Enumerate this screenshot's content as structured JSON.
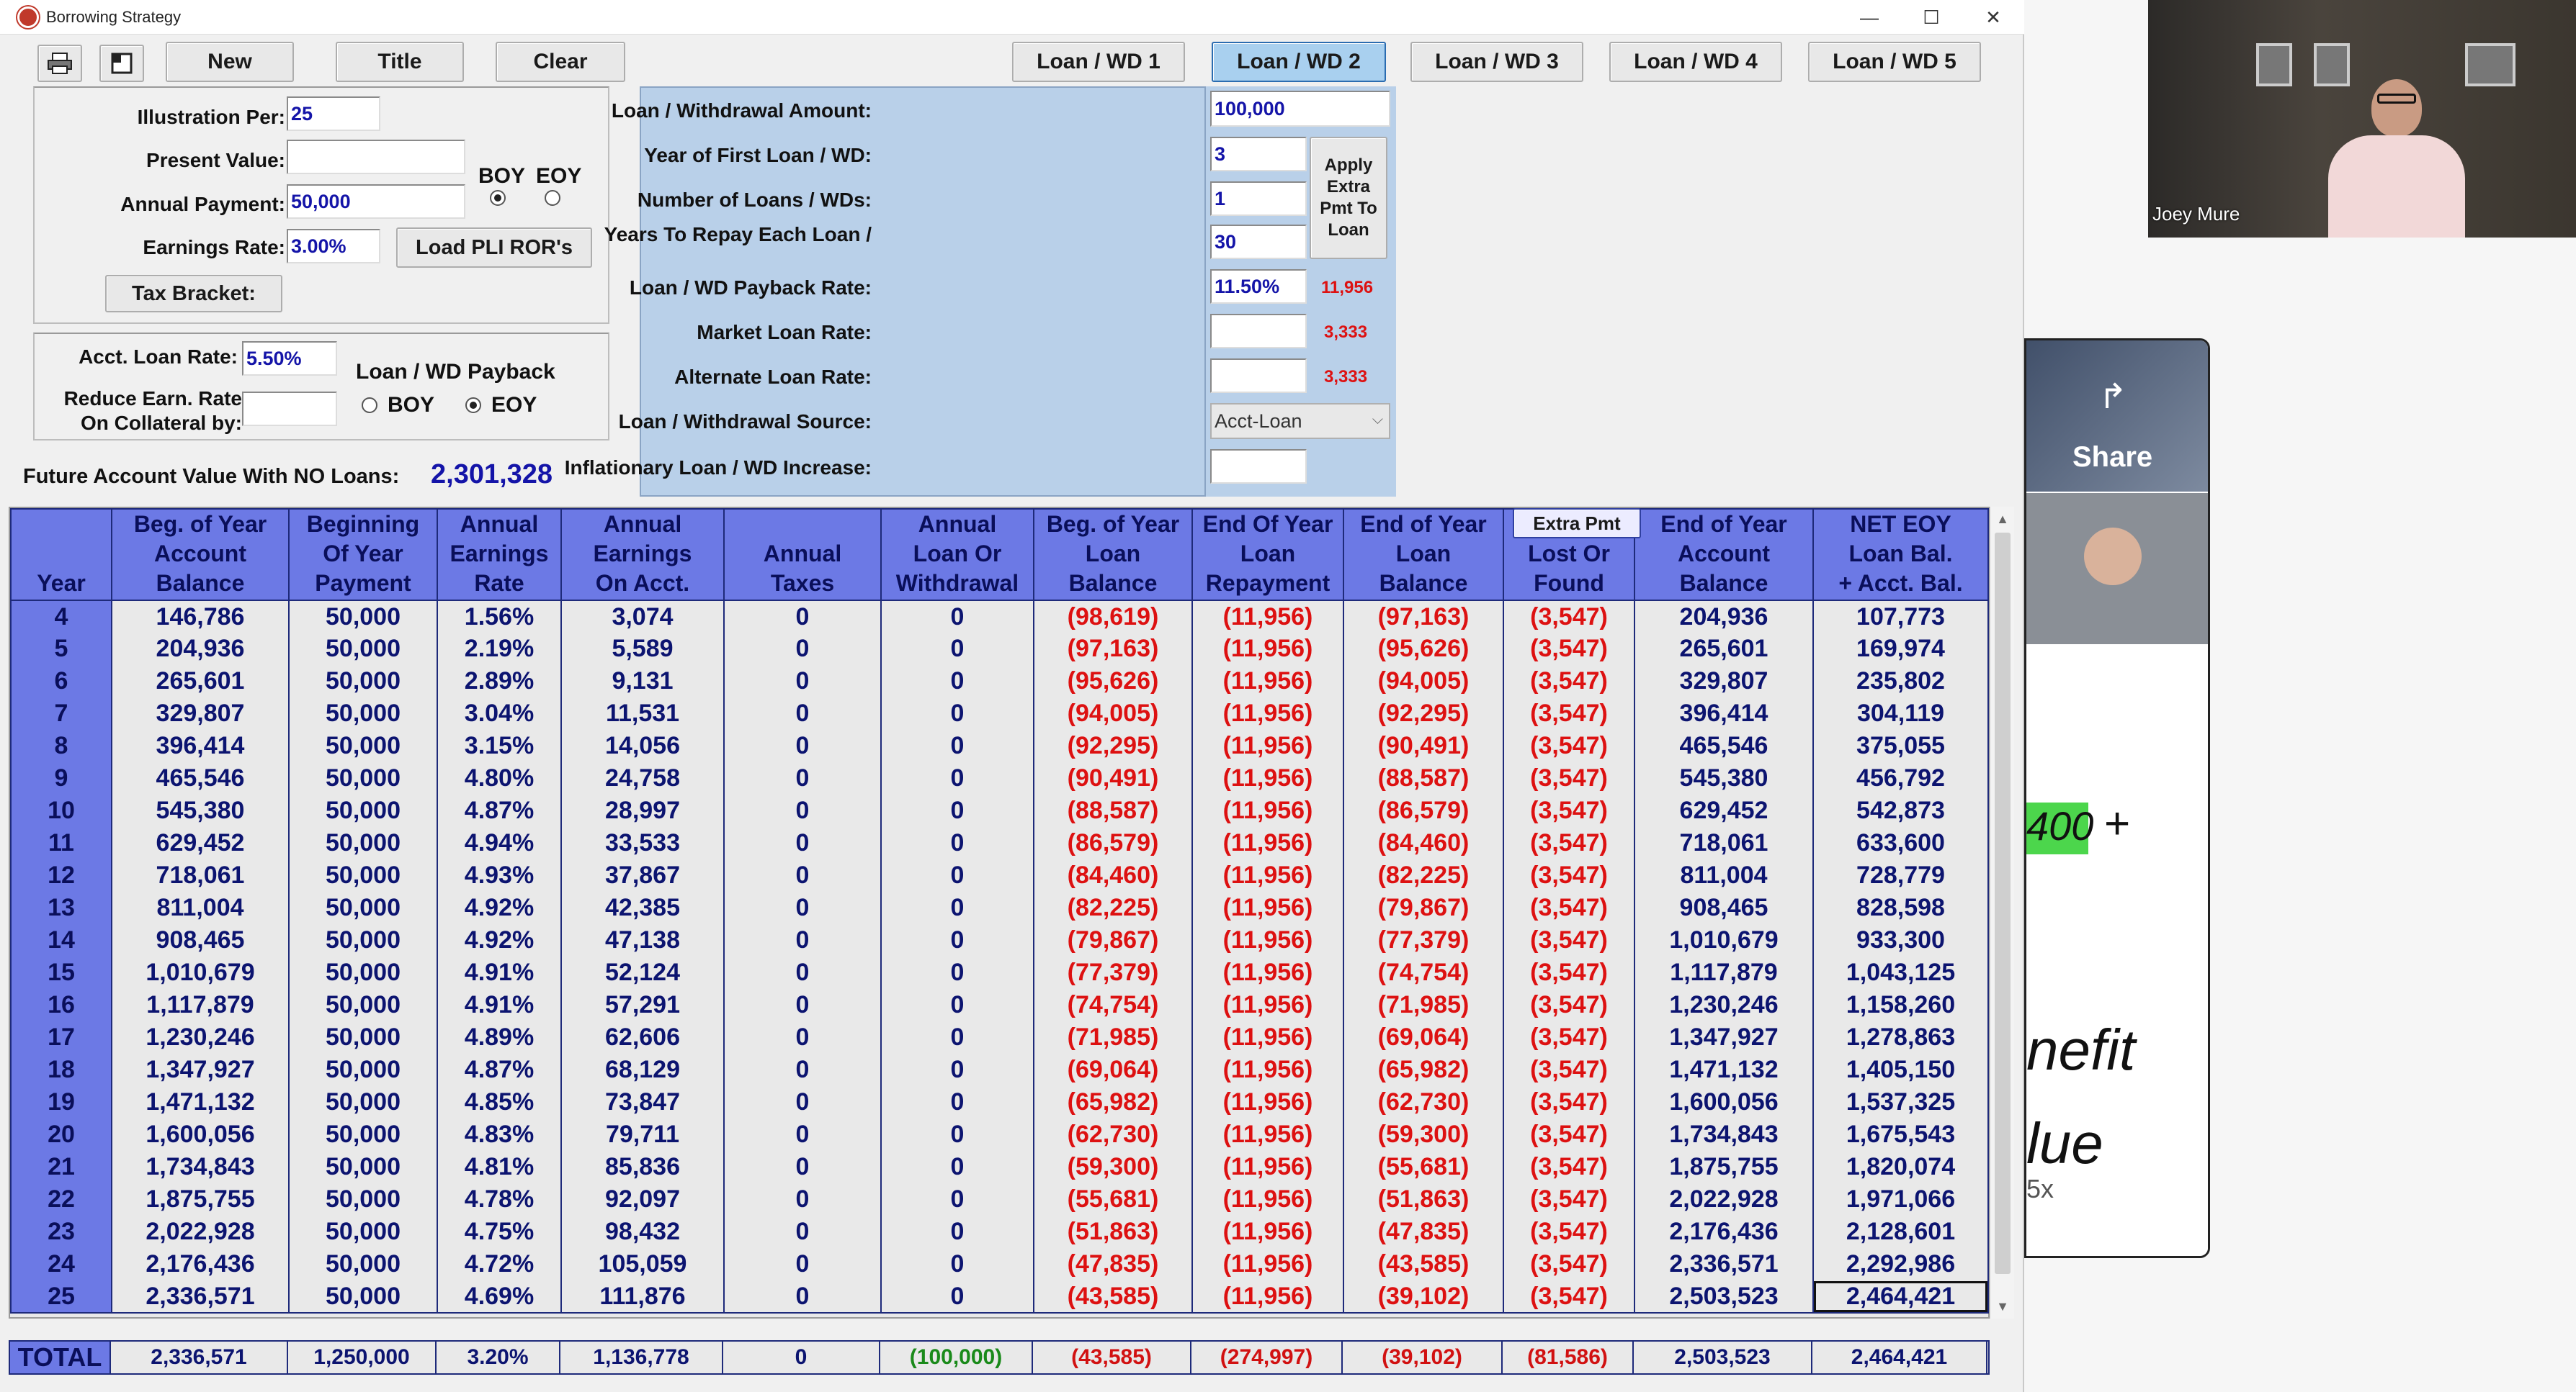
{
  "window": {
    "title": "Borrowing Strategy",
    "minimize": "—",
    "maximize": "☐",
    "close": "✕"
  },
  "toolbar": {
    "print_icon": "printer-icon",
    "preview_icon": "preview-icon",
    "new": "New",
    "title": "Title",
    "clear": "Clear"
  },
  "tabs": [
    "Loan / WD 1",
    "Loan / WD 2",
    "Loan / WD 3",
    "Loan / WD 4",
    "Loan / WD 5"
  ],
  "inputs": {
    "illustration_label": "Illustration Per:",
    "illustration": "25",
    "present_value_label": "Present Value:",
    "present_value": "",
    "annual_payment_label": "Annual Payment:",
    "annual_payment": "50,000",
    "earnings_rate_label": "Earnings Rate:",
    "earnings_rate": "3.00%",
    "boy": "BOY",
    "eoy": "EOY",
    "load_btn": "Load PLI ROR's",
    "tax_bracket": "Tax Bracket:"
  },
  "loan_opts": {
    "acct_rate_label": "Acct. Loan Rate:",
    "acct_rate": "5.50%",
    "payback_label": "Loan / WD Payback",
    "reduce_label1": "Reduce Earn. Rate",
    "reduce_label2": "On Collateral by:",
    "boy": "BOY",
    "eoy": "EOY"
  },
  "future_value": {
    "label": "Future Account Value With NO Loans:",
    "value": "2,301,328"
  },
  "loan_panel": {
    "amount_label": "Loan / Withdrawal Amount:",
    "amount": "100,000",
    "first_year_label": "Year of First Loan / WD:",
    "first_year": "3",
    "number_label": "Number of Loans / WDs:",
    "number": "1",
    "years_repay_label": "Years To Repay Each Loan /",
    "years_repay": "30",
    "payback_rate_label": "Loan / WD Payback Rate:",
    "payback_rate": "11.50%",
    "payback_amt": "11,956",
    "market_rate_label": "Market Loan Rate:",
    "market_amt": "3,333",
    "alt_rate_label": "Alternate Loan Rate:",
    "alt_amt": "3,333",
    "source_label": "Loan / Withdrawal Source:",
    "source": "Acct-Loan",
    "inflation_label": "Inflationary Loan / WD Increase:",
    "apply_btn": "Apply Extra Pmt To Loan"
  },
  "table": {
    "extra_pmt_btn": "Extra Pmt",
    "headers": [
      "Year",
      "Beg. of Year\nAccount\nBalance",
      "Beginning\nOf Year\nPayment",
      "Annual\nEarnings\nRate",
      "Annual\nEarnings\nOn Acct.",
      "Annual\nTaxes",
      "Annual\nLoan Or\nWithdrawal",
      "Beg. of Year\nLoan\nBalance",
      "End Of Year\nLoan\nRepayment",
      "End of Year\nLoan\nBalance",
      "Lost Or\nFound",
      "End of Year\nAccount\nBalance",
      "NET EOY\nLoan Bal.\n+ Acct. Bal."
    ],
    "rows": [
      [
        "4",
        "146,786",
        "50,000",
        "1.56%",
        "3,074",
        "0",
        "0",
        "(98,619)",
        "(11,956)",
        "(97,163)",
        "(3,547)",
        "204,936",
        "107,773"
      ],
      [
        "5",
        "204,936",
        "50,000",
        "2.19%",
        "5,589",
        "0",
        "0",
        "(97,163)",
        "(11,956)",
        "(95,626)",
        "(3,547)",
        "265,601",
        "169,974"
      ],
      [
        "6",
        "265,601",
        "50,000",
        "2.89%",
        "9,131",
        "0",
        "0",
        "(95,626)",
        "(11,956)",
        "(94,005)",
        "(3,547)",
        "329,807",
        "235,802"
      ],
      [
        "7",
        "329,807",
        "50,000",
        "3.04%",
        "11,531",
        "0",
        "0",
        "(94,005)",
        "(11,956)",
        "(92,295)",
        "(3,547)",
        "396,414",
        "304,119"
      ],
      [
        "8",
        "396,414",
        "50,000",
        "3.15%",
        "14,056",
        "0",
        "0",
        "(92,295)",
        "(11,956)",
        "(90,491)",
        "(3,547)",
        "465,546",
        "375,055"
      ],
      [
        "9",
        "465,546",
        "50,000",
        "4.80%",
        "24,758",
        "0",
        "0",
        "(90,491)",
        "(11,956)",
        "(88,587)",
        "(3,547)",
        "545,380",
        "456,792"
      ],
      [
        "10",
        "545,380",
        "50,000",
        "4.87%",
        "28,997",
        "0",
        "0",
        "(88,587)",
        "(11,956)",
        "(86,579)",
        "(3,547)",
        "629,452",
        "542,873"
      ],
      [
        "11",
        "629,452",
        "50,000",
        "4.94%",
        "33,533",
        "0",
        "0",
        "(86,579)",
        "(11,956)",
        "(84,460)",
        "(3,547)",
        "718,061",
        "633,600"
      ],
      [
        "12",
        "718,061",
        "50,000",
        "4.93%",
        "37,867",
        "0",
        "0",
        "(84,460)",
        "(11,956)",
        "(82,225)",
        "(3,547)",
        "811,004",
        "728,779"
      ],
      [
        "13",
        "811,004",
        "50,000",
        "4.92%",
        "42,385",
        "0",
        "0",
        "(82,225)",
        "(11,956)",
        "(79,867)",
        "(3,547)",
        "908,465",
        "828,598"
      ],
      [
        "14",
        "908,465",
        "50,000",
        "4.92%",
        "47,138",
        "0",
        "0",
        "(79,867)",
        "(11,956)",
        "(77,379)",
        "(3,547)",
        "1,010,679",
        "933,300"
      ],
      [
        "15",
        "1,010,679",
        "50,000",
        "4.91%",
        "52,124",
        "0",
        "0",
        "(77,379)",
        "(11,956)",
        "(74,754)",
        "(3,547)",
        "1,117,879",
        "1,043,125"
      ],
      [
        "16",
        "1,117,879",
        "50,000",
        "4.91%",
        "57,291",
        "0",
        "0",
        "(74,754)",
        "(11,956)",
        "(71,985)",
        "(3,547)",
        "1,230,246",
        "1,158,260"
      ],
      [
        "17",
        "1,230,246",
        "50,000",
        "4.89%",
        "62,606",
        "0",
        "0",
        "(71,985)",
        "(11,956)",
        "(69,064)",
        "(3,547)",
        "1,347,927",
        "1,278,863"
      ],
      [
        "18",
        "1,347,927",
        "50,000",
        "4.87%",
        "68,129",
        "0",
        "0",
        "(69,064)",
        "(11,956)",
        "(65,982)",
        "(3,547)",
        "1,471,132",
        "1,405,150"
      ],
      [
        "19",
        "1,471,132",
        "50,000",
        "4.85%",
        "73,847",
        "0",
        "0",
        "(65,982)",
        "(11,956)",
        "(62,730)",
        "(3,547)",
        "1,600,056",
        "1,537,325"
      ],
      [
        "20",
        "1,600,056",
        "50,000",
        "4.83%",
        "79,711",
        "0",
        "0",
        "(62,730)",
        "(11,956)",
        "(59,300)",
        "(3,547)",
        "1,734,843",
        "1,675,543"
      ],
      [
        "21",
        "1,734,843",
        "50,000",
        "4.81%",
        "85,836",
        "0",
        "0",
        "(59,300)",
        "(11,956)",
        "(55,681)",
        "(3,547)",
        "1,875,755",
        "1,820,074"
      ],
      [
        "22",
        "1,875,755",
        "50,000",
        "4.78%",
        "92,097",
        "0",
        "0",
        "(55,681)",
        "(11,956)",
        "(51,863)",
        "(3,547)",
        "2,022,928",
        "1,971,066"
      ],
      [
        "23",
        "2,022,928",
        "50,000",
        "4.75%",
        "98,432",
        "0",
        "0",
        "(51,863)",
        "(11,956)",
        "(47,835)",
        "(3,547)",
        "2,176,436",
        "2,128,601"
      ],
      [
        "24",
        "2,176,436",
        "50,000",
        "4.72%",
        "105,059",
        "0",
        "0",
        "(47,835)",
        "(11,956)",
        "(43,585)",
        "(3,547)",
        "2,336,571",
        "2,292,986"
      ],
      [
        "25",
        "2,336,571",
        "50,000",
        "4.69%",
        "111,876",
        "0",
        "0",
        "(43,585)",
        "(11,956)",
        "(39,102)",
        "(3,547)",
        "2,503,523",
        "2,464,421"
      ]
    ],
    "totals": [
      "TOTAL",
      "2,336,571",
      "1,250,000",
      "3.20%",
      "1,136,778",
      "0",
      "(100,000)",
      "(43,585)",
      "(274,997)",
      "(39,102)",
      "(81,586)",
      "2,503,523",
      "2,464,421"
    ]
  },
  "video": {
    "name": "Joey Mure"
  },
  "side": {
    "share": "Share",
    "scribble1": "400",
    "plus": "+",
    "scribble2": "nefit",
    "scribble3": "lue",
    "speed": "5x"
  },
  "colors": {
    "header": "#6c79e5",
    "negative": "#d11111",
    "value": "#0c1470",
    "panel": "#b9d0e9",
    "green": "#1a8a1a"
  }
}
